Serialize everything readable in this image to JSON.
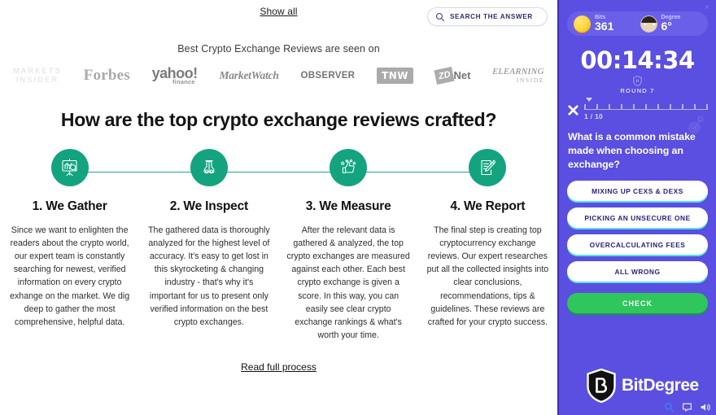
{
  "page": {
    "show_all_label": "Show all",
    "search": {
      "placeholder": "SEARCH THE ANSWER",
      "icon": "search-icon"
    },
    "seen_on_label": "Best Crypto Exchange Reviews are seen on",
    "press_logos": [
      {
        "name": "markets-insider",
        "line1": "MARKETS",
        "line2": "INSIDER"
      },
      {
        "name": "forbes",
        "text": "Forbes"
      },
      {
        "name": "yahoo-finance",
        "text": "yahoo!",
        "sub": "finance"
      },
      {
        "name": "marketwatch",
        "text": "MarketWatch"
      },
      {
        "name": "observer",
        "text": "OBSERVER"
      },
      {
        "name": "tnw",
        "text": "TNW"
      },
      {
        "name": "zdnet",
        "text": "ZD",
        "sub": "Net"
      },
      {
        "name": "elearning-inside",
        "text": "ELEARNING",
        "sub": "INSIDE"
      }
    ],
    "main_title": "How are the top crypto exchange reviews crafted?",
    "steps": [
      {
        "icon": "chart-analysis-icon",
        "title": "1. We Gather",
        "body": "Since we want to enlighten the readers about the crypto world, our expert team is constantly searching for newest, verified information on every crypto exhange on the market. We dig deep to gather the most comprehensive, helpful data."
      },
      {
        "icon": "binoculars-icon",
        "title": "2. We Inspect",
        "body": "The gathered data is thoroughly analyzed for the highest level of accuracy. It's easy to get lost in this skyrocketing & changing industry - that's why it's important for us to present only verified information on the best crypto exchanges."
      },
      {
        "icon": "thumbs-up-stars-icon",
        "title": "3. We Measure",
        "body": "After the relevant data is gathered & analyzed, the top crypto exchanges are measured against each other. Each best crypto exchange is given a score. In this way, you can easily see clear crypto exchange rankings & what's worth your time."
      },
      {
        "icon": "document-pencil-icon",
        "title": "4. We Report",
        "body": "The final step is creating top cryptocurrency exchange reviews. Our expert researches put all the collected insights into clear conclusions, recommendations, tips & guidelines. These reviews are crafted for your crypto success."
      }
    ],
    "read_full_label": "Read full process"
  },
  "quiz": {
    "close_label": "×",
    "stats": [
      {
        "icon": "coin-icon",
        "label": "Bits",
        "value": "361"
      },
      {
        "icon": "avatar-icon",
        "label": "Degree",
        "value": "6°"
      }
    ],
    "timer": "00:14:34",
    "round_label": "ROUND 7",
    "progress": {
      "current": 1,
      "total": 10,
      "text": "1 / 10",
      "ticks": 10
    },
    "question": "What is a common mistake made when choosing an exchange?",
    "answers": [
      "MIXING UP CEXS & DEXS",
      "PICKING AN UNSECURE ONE",
      "OVERCALCULATING FEES",
      "ALL WRONG"
    ],
    "check_label": "CHECK",
    "brand_name": "BitDegree",
    "footer_icons": [
      "search-icon",
      "chat-icon",
      "sound-icon"
    ],
    "colors": {
      "panel_bg": "#5a4fe0",
      "pill_bg": "#6a5fe8",
      "answer_shadow": "#54e1e8",
      "check_green": "#2fc65c",
      "answer_text": "#2a2177"
    }
  },
  "theme": {
    "accent_green": "#14a37f",
    "connector_green": "#24a87a",
    "link_color": "#111111"
  }
}
